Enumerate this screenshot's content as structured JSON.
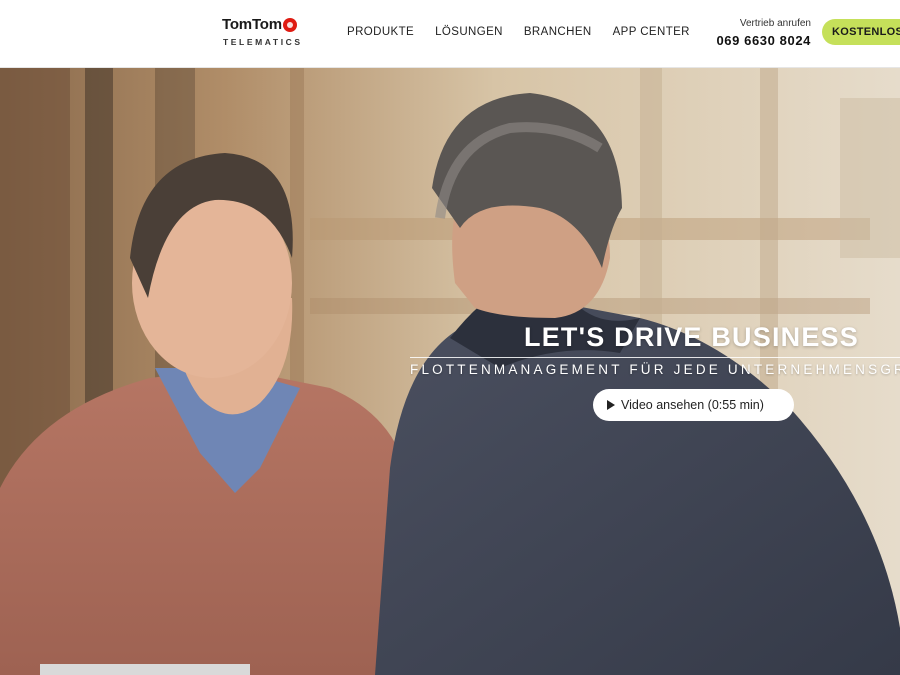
{
  "header": {
    "logo": {
      "brand": "TomTom",
      "sub": "TELEMATICS"
    },
    "nav": [
      {
        "label": "PRODUKTE"
      },
      {
        "label": "LÖSUNGEN"
      },
      {
        "label": "BRANCHEN"
      },
      {
        "label": "APP CENTER"
      }
    ],
    "contact": {
      "label": "Vertrieb anrufen",
      "phone": "069 6630 8024"
    },
    "cta_label": "KOSTENLOS"
  },
  "hero": {
    "title": "LET'S DRIVE BUSINESS",
    "subtitle": "FLOTTENMANAGEMENT FÜR JEDE UNTERNEHMENSGRÖSSE",
    "video_button_label": "Video ansehen (0:55 min)"
  },
  "colors": {
    "brand_red": "#df1b12",
    "cta_green": "#c5e05a",
    "header_bg": "#ffffff"
  }
}
